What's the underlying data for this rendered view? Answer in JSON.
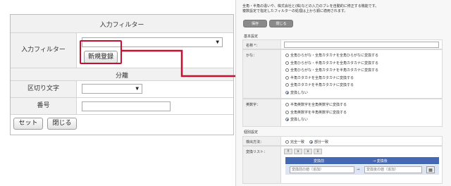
{
  "left_panel": {
    "header": "入力フィルター",
    "filter_label": "入力フィルター",
    "register_button": "新規登録",
    "section_divider": "分離",
    "delimiter_label": "区切り文字",
    "number_label": "番号",
    "set_button": "セット",
    "close_button": "閉じる"
  },
  "right_panel": {
    "desc_line1": "全角・半角の違いや、株式会社と(株)などの入力のブレを自動的に修正する機能です。",
    "desc_line2": "複数設定で指定したフィルターの処理は上から順に適用されます。",
    "save_button": "保存",
    "close_button": "閉じる",
    "basic_title": "基本設定",
    "name_label": "名称 *：",
    "kana_label": "かな：",
    "kana_options": [
      "全角ひらがな・全角カタカナを全角ひらがなに変換する",
      "全角ひらがな・半角カタカナを全角カタカナに変換する",
      "全角ひらがな・全角カタカナを半角カタカナに変換する",
      "半角カタカナを全角カタカナに変換する",
      "全角カタカナを半角カタカナに変換する",
      "変換しない"
    ],
    "kana_selected": 5,
    "alnum_label": "英数字：",
    "alnum_options": [
      "半角英数字を全角英数字に変換する",
      "全角英数字を半角英数字に変換する",
      "変換しない"
    ],
    "alnum_selected": 2,
    "individual_title": "個別設定",
    "match_label": "検出方法：",
    "match_options": [
      "完全一致",
      "部分一致"
    ],
    "match_selected": 1,
    "list_label": "変換リスト：",
    "table_col_before": "変換前",
    "table_col_after": "→ 変換後",
    "before_placeholder": "変換前の値（追加）",
    "arrow": "→",
    "after_placeholder": "変換後の値（追加）"
  },
  "colors": {
    "highlight": "#c8102e",
    "table_header": "#4468b4"
  }
}
